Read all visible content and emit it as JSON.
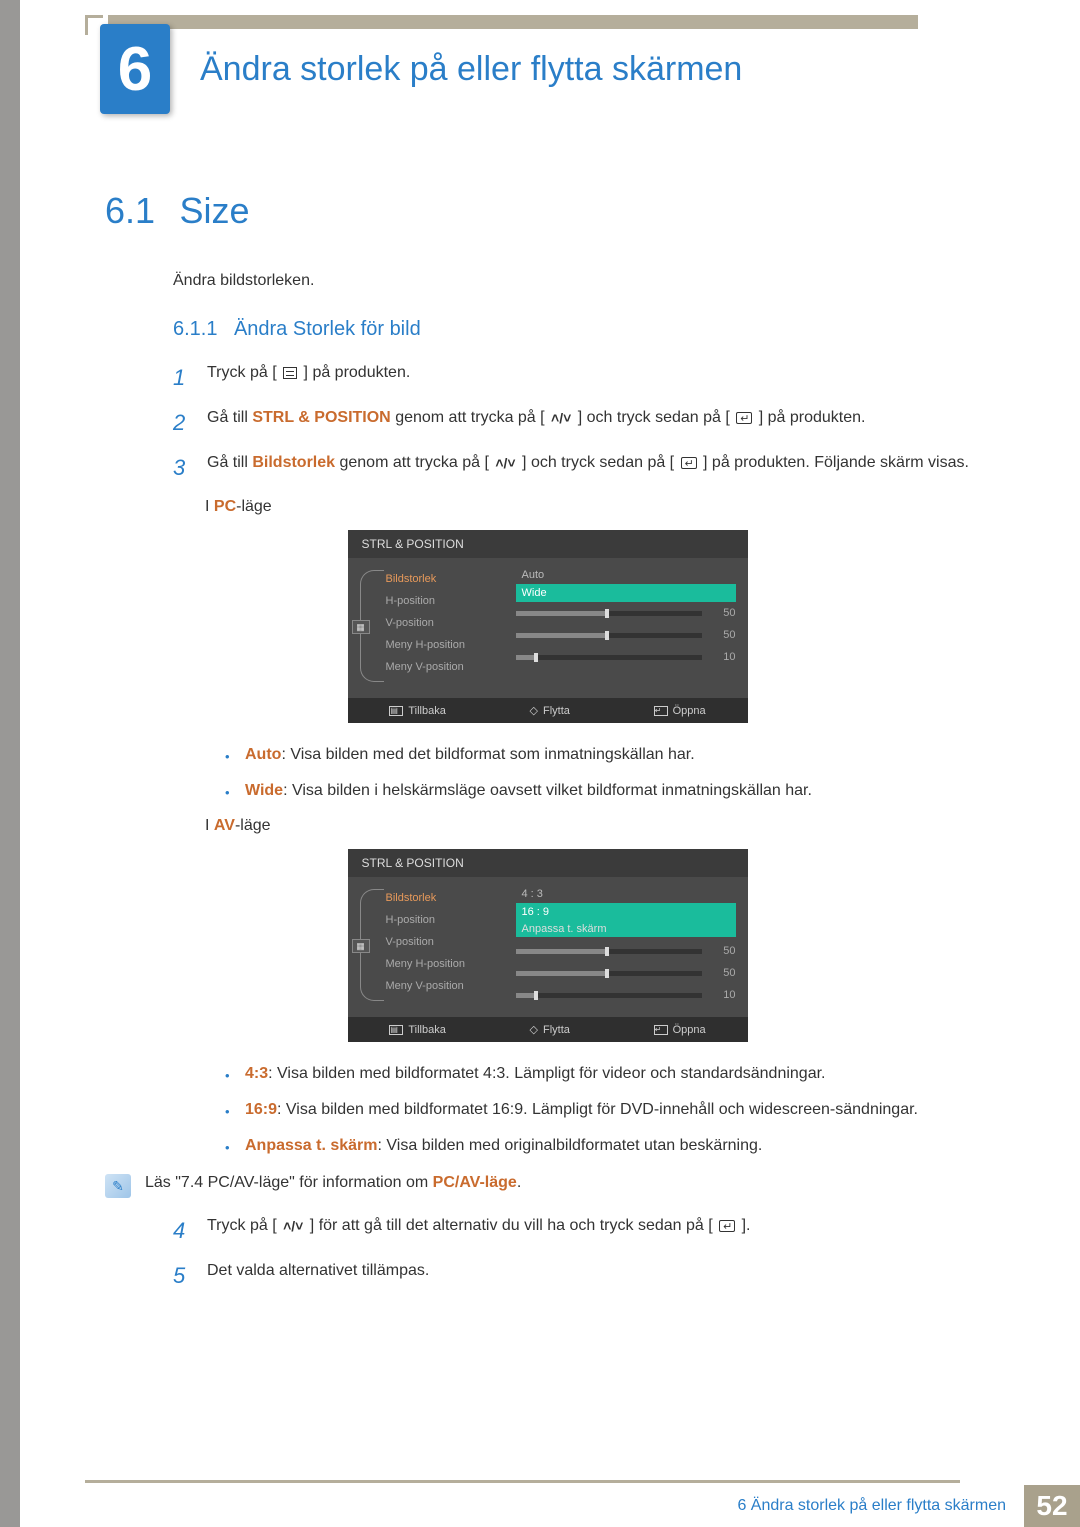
{
  "chapter": {
    "number": "6",
    "title": "Ändra storlek på eller flytta skärmen"
  },
  "section": {
    "number": "6.1",
    "title": "Size",
    "intro": "Ändra bildstorleken."
  },
  "subsection": {
    "number": "6.1.1",
    "title": "Ändra Storlek för bild"
  },
  "steps": {
    "s1": {
      "num": "1",
      "a": "Tryck på [",
      "b": "] på produkten."
    },
    "s2": {
      "num": "2",
      "a": "Gå till ",
      "b": "STRL & POSITION",
      "c": " genom att trycka på [",
      "d": "] och tryck sedan på [",
      "e": "] på produkten."
    },
    "s3": {
      "num": "3",
      "a": "Gå till ",
      "b": "Bildstorlek",
      "c": " genom att trycka på [",
      "d": "] och tryck sedan på [",
      "e": "] på produkten. Följande skärm visas."
    },
    "s4": {
      "num": "4",
      "a": "Tryck på [",
      "b": "] för att gå till det alternativ du vill ha och tryck sedan på [",
      "c": "]."
    },
    "s5": {
      "num": "5",
      "a": "Det valda alternativet tillämpas."
    }
  },
  "mode_pc": {
    "prefix": "I ",
    "label": "PC",
    "suffix": "-läge"
  },
  "mode_av": {
    "prefix": "I ",
    "label": "AV",
    "suffix": "-läge"
  },
  "osd": {
    "title": "STRL & POSITION",
    "menu": [
      "Bildstorlek",
      "H-position",
      "V-position",
      "Meny H-position",
      "Meny V-position"
    ],
    "pc_opts": [
      "Auto",
      "Wide"
    ],
    "av_opts": [
      "4 : 3",
      "16 : 9",
      "Anpassa t. skärm"
    ],
    "sliders": [
      {
        "val": "50",
        "fill": 48
      },
      {
        "val": "50",
        "fill": 48
      },
      {
        "val": "10",
        "fill": 10
      }
    ],
    "footer": {
      "back": "Tillbaka",
      "move": "Flytta",
      "open": "Öppna"
    }
  },
  "bullets_pc": [
    {
      "b": "Auto",
      "t": ": Visa bilden med det bildformat som inmatningskällan har."
    },
    {
      "b": "Wide",
      "t": ": Visa bilden i helskärmsläge oavsett vilket bildformat inmatningskällan har."
    }
  ],
  "bullets_av": [
    {
      "b": "4:3",
      "t": ": Visa bilden med bildformatet 4:3. Lämpligt för videor och standardsändningar."
    },
    {
      "b": "16:9",
      "t": ": Visa bilden med bildformatet 16:9. Lämpligt för DVD-innehåll och widescreen-sändningar."
    },
    {
      "b": "Anpassa t. skärm",
      "t": ": Visa bilden med originalbildformatet utan beskärning."
    }
  ],
  "note": {
    "a": "Läs \"7.4 PC/AV-läge\" för information om ",
    "b": "PC/AV-läge",
    "c": "."
  },
  "footer": {
    "title": "6 Ändra storlek på eller flytta skärmen",
    "page": "52"
  }
}
